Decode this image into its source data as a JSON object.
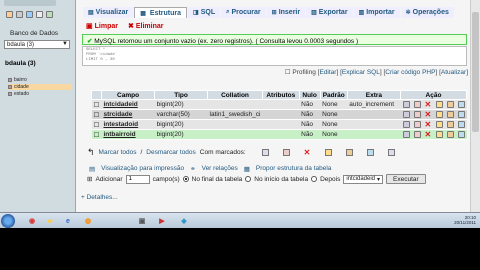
{
  "sidebar": {
    "db_label": "Banco de Dados",
    "db_selected": "bdaula (3)",
    "db_heading": "bdaula (3)",
    "tables": [
      "bairro",
      "cidade",
      "estado"
    ]
  },
  "tabs": {
    "visualizar": "Visualizar",
    "estrutura": "Estrutura",
    "sql": "SQL",
    "procurar": "Procurar",
    "inserir": "Inserir",
    "exportar": "Exportar",
    "importar": "Importar",
    "operacoes": "Operações",
    "limpar": "Limpar",
    "eliminar": "Eliminar"
  },
  "message": "MySQL retornou um conjunto vazio (ex. zero registros). ( Consulta levou 0.0003 segundos )",
  "sql_lines": [
    "SELECT *",
    "FROM `cidade`",
    "LIMIT 0 , 30"
  ],
  "profiling": {
    "label": "Profiling",
    "edit": "Editar",
    "explain": "Explicar SQL",
    "php": "Criar código PHP",
    "refresh": "Atualizar"
  },
  "columns": [
    "Campo",
    "Tipo",
    "Collation",
    "Atributos",
    "Nulo",
    "Padrão",
    "Extra",
    "Ação"
  ],
  "rows": [
    {
      "campo": "intcidadeid",
      "tipo": "bigint(20)",
      "collation": "",
      "atributos": "",
      "nulo": "Não",
      "padrao": "None",
      "extra": "auto_increment"
    },
    {
      "campo": "strcidade",
      "tipo": "varchar(50)",
      "collation": "latin1_swedish_ci",
      "atributos": "",
      "nulo": "Não",
      "padrao": "None",
      "extra": ""
    },
    {
      "campo": "intestadoid",
      "tipo": "bigint(20)",
      "collation": "",
      "atributos": "",
      "nulo": "Não",
      "padrao": "None",
      "extra": ""
    },
    {
      "campo": "intbairroid",
      "tipo": "bigint(20)",
      "collation": "",
      "atributos": "",
      "nulo": "Não",
      "padrao": "None",
      "extra": ""
    }
  ],
  "mark": {
    "all": "Marcar todos",
    "sep": " / ",
    "none": "Desmarcar todos",
    "with": "Com marcados:"
  },
  "print_view": "Visualização para impressão",
  "relations": "Ver relações",
  "propose": "Propor estrutura da tabela",
  "add": {
    "label": "Adicionar",
    "count": "1",
    "fields": "campo(s)",
    "end": "No final da tabela",
    "start": "No início da tabela",
    "after": "Depois",
    "after_col": "intcidadeid",
    "button": "Executar"
  },
  "details": "Detalhes...",
  "clock": {
    "time": "20:10",
    "date": "20/11/2011"
  }
}
